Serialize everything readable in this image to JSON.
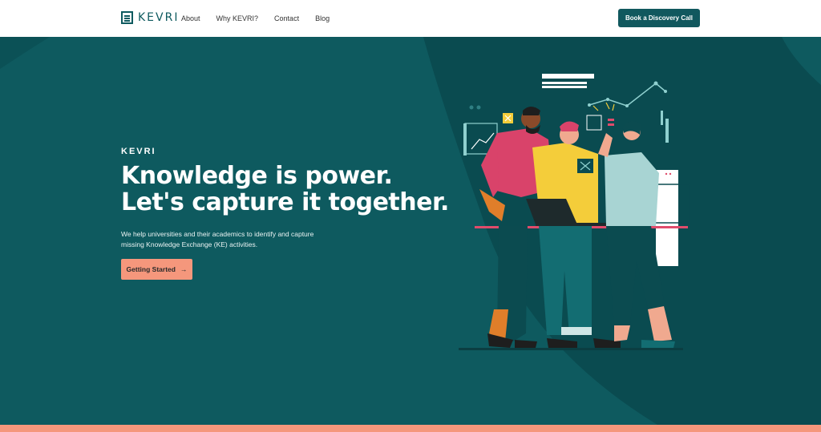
{
  "nav": {
    "logo_text": "KEVRI",
    "links": [
      "About",
      "Why KEVRI?",
      "Contact",
      "Blog"
    ],
    "cta_label": "Book a Discovery Call"
  },
  "hero": {
    "eyebrow": "KEVRI",
    "title_line1": "Knowledge is power.",
    "title_line2": "Let's capture it together.",
    "description": "We help universities and their academics to identify and capture missing Knowledge Exchange (KE) activities.",
    "button_label": "Getting Started",
    "button_icon": "arrow-right-icon"
  },
  "colors": {
    "primary": "#0e5a5f",
    "accent": "#f5977c",
    "white": "#ffffff"
  }
}
